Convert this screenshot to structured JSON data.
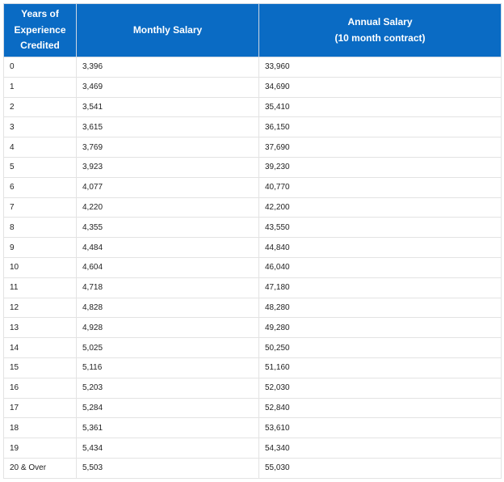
{
  "table": {
    "headers": {
      "col1": [
        "Years of",
        "Experience",
        "Credited"
      ],
      "col2": "Monthly Salary",
      "col3": [
        "Annual Salary",
        "(10 month contract)"
      ]
    },
    "rows": [
      {
        "years": "0",
        "monthly": "3,396",
        "annual": "33,960"
      },
      {
        "years": "1",
        "monthly": "3,469",
        "annual": "34,690"
      },
      {
        "years": "2",
        "monthly": "3,541",
        "annual": "35,410"
      },
      {
        "years": "3",
        "monthly": "3,615",
        "annual": "36,150"
      },
      {
        "years": "4",
        "monthly": "3,769",
        "annual": "37,690"
      },
      {
        "years": "5",
        "monthly": "3,923",
        "annual": "39,230"
      },
      {
        "years": "6",
        "monthly": "4,077",
        "annual": "40,770"
      },
      {
        "years": "7",
        "monthly": "4,220",
        "annual": "42,200"
      },
      {
        "years": "8",
        "monthly": "4,355",
        "annual": "43,550"
      },
      {
        "years": "9",
        "monthly": "4,484",
        "annual": "44,840"
      },
      {
        "years": "10",
        "monthly": "4,604",
        "annual": "46,040"
      },
      {
        "years": "11",
        "monthly": "4,718",
        "annual": "47,180"
      },
      {
        "years": "12",
        "monthly": "4,828",
        "annual": "48,280"
      },
      {
        "years": "13",
        "monthly": "4,928",
        "annual": "49,280"
      },
      {
        "years": "14",
        "monthly": "5,025",
        "annual": "50,250"
      },
      {
        "years": "15",
        "monthly": "5,116",
        "annual": "51,160"
      },
      {
        "years": "16",
        "monthly": "5,203",
        "annual": "52,030"
      },
      {
        "years": "17",
        "monthly": "5,284",
        "annual": "52,840"
      },
      {
        "years": "18",
        "monthly": "5,361",
        "annual": "53,610"
      },
      {
        "years": "19",
        "monthly": "5,434",
        "annual": "54,340"
      },
      {
        "years": "20 & Over",
        "monthly": "5,503",
        "annual": "55,030"
      }
    ]
  },
  "colors": {
    "header_background": "#0a6bc4",
    "header_text": "#ffffff",
    "row_border": "#e3e3e3"
  }
}
